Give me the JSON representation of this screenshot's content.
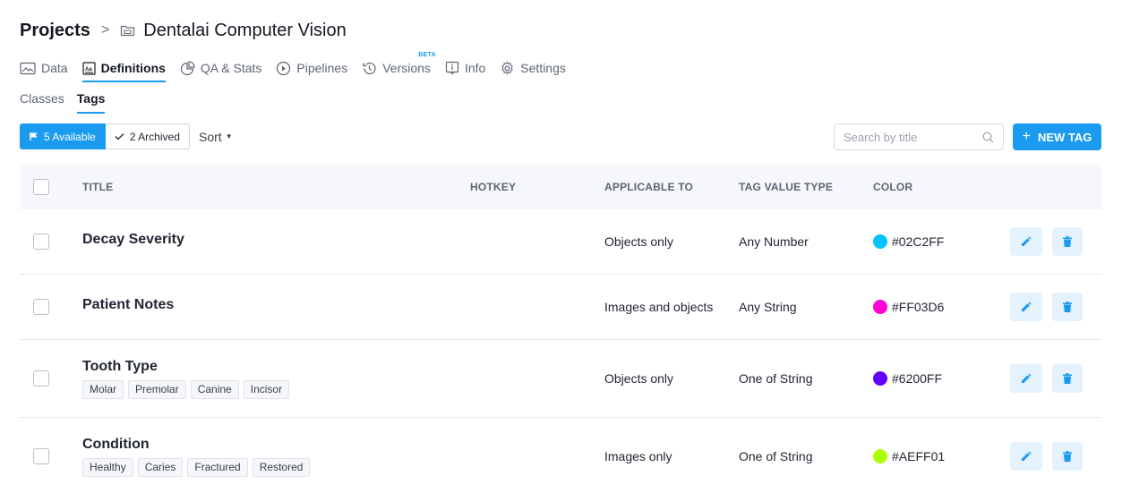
{
  "breadcrumb": {
    "root": "Projects",
    "separator": ">",
    "project": "Dentalai Computer Vision"
  },
  "main_tabs": [
    {
      "label": "Data",
      "icon": "image-icon"
    },
    {
      "label": "Definitions",
      "icon": "text-box-icon",
      "active": true
    },
    {
      "label": "QA & Stats",
      "icon": "pie-chart-icon"
    },
    {
      "label": "Pipelines",
      "icon": "play-circle-icon"
    },
    {
      "label": "Versions",
      "icon": "history-icon",
      "badge": "BETA"
    },
    {
      "label": "Info",
      "icon": "info-icon"
    },
    {
      "label": "Settings",
      "icon": "gear-icon"
    }
  ],
  "sub_tabs": [
    {
      "label": "Classes"
    },
    {
      "label": "Tags",
      "active": true
    }
  ],
  "toolbar": {
    "available_label": "5 Available",
    "archived_label": "2 Archived",
    "sort_label": "Sort",
    "search_placeholder": "Search by title",
    "new_tag_label": "NEW TAG"
  },
  "table": {
    "headers": {
      "title": "TITLE",
      "hotkey": "HOTKEY",
      "applicable": "APPLICABLE TO",
      "value_type": "TAG VALUE TYPE",
      "color": "COLOR"
    },
    "rows": [
      {
        "title": "Decay Severity",
        "hotkey": "",
        "applicable": "Objects only",
        "value_type": "Any Number",
        "color": "#02C2FF",
        "options": []
      },
      {
        "title": "Patient Notes",
        "hotkey": "",
        "applicable": "Images and objects",
        "value_type": "Any String",
        "color": "#FF03D6",
        "options": []
      },
      {
        "title": "Tooth Type",
        "hotkey": "",
        "applicable": "Objects only",
        "value_type": "One of String",
        "color": "#6200FF",
        "options": [
          "Molar",
          "Premolar",
          "Canine",
          "Incisor"
        ]
      },
      {
        "title": "Condition",
        "hotkey": "",
        "applicable": "Images only",
        "value_type": "One of String",
        "color": "#AEFF01",
        "options": [
          "Healthy",
          "Caries",
          "Fractured",
          "Restored"
        ]
      }
    ]
  },
  "colors": {
    "accent": "#1a9bf0",
    "action_bg": "#e3f2fd"
  }
}
